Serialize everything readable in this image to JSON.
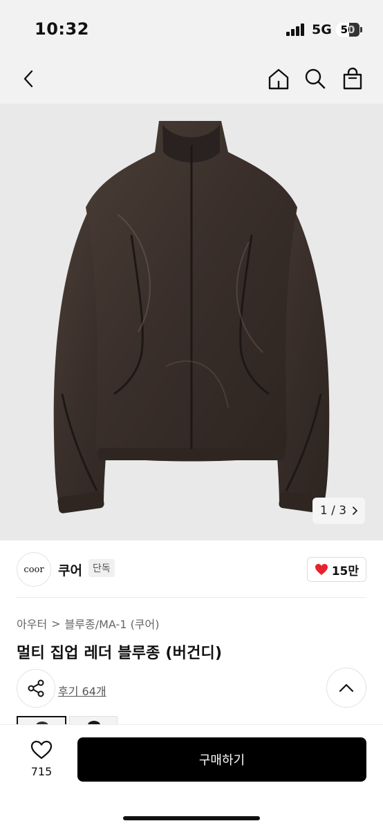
{
  "status_bar": {
    "time": "10:32",
    "network": "5G",
    "battery": "50"
  },
  "nav": {
    "back_icon": "chevron-left-icon",
    "home_icon": "home-icon",
    "search_icon": "search-icon",
    "cart_icon": "shopping-bag-icon"
  },
  "gallery": {
    "current": "1",
    "separator": "/",
    "total": "3"
  },
  "brand": {
    "logo_text": "coor",
    "name": "쿠어",
    "badge": "단독",
    "like_count": "15만"
  },
  "breadcrumb": {
    "level1": "아우터",
    "separator": ">",
    "level2": "블루종/MA-1 (쿠어)"
  },
  "product": {
    "title": "멀티 집업 레더 블루종 (버건디)",
    "reviews": "후기 64개"
  },
  "bottom_bar": {
    "wish_count": "715",
    "buy_label": "구매하기"
  },
  "colors": {
    "heart": "#e8232e",
    "jacket": "#3b302b",
    "background": "#e9e9e9"
  }
}
